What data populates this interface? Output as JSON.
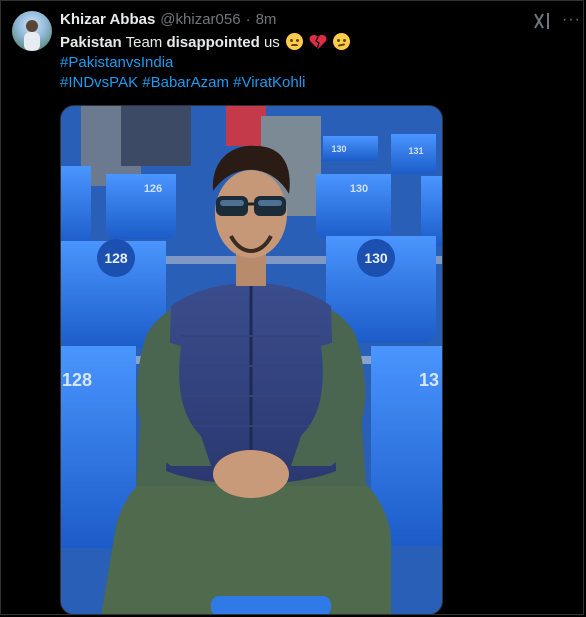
{
  "tweet": {
    "author_name": "Khizar Abbas",
    "handle": "@khizar056",
    "separator": "·",
    "time": "8m",
    "more_label": "···",
    "text": {
      "line1_bold1": "Pakistan",
      "line1_text1": " Team ",
      "line1_bold2": "disappointed",
      "line1_text2": " us ",
      "hashtag1": "#PakistanvsIndia",
      "hashtag2": "#INDvsPAK",
      "hashtag3": "#BabarAzam",
      "hashtag4": "#ViratKohli"
    },
    "emojis": [
      "disappointed-face-emoji",
      "broken-heart-emoji",
      "confused-face-emoji"
    ]
  },
  "photo": {
    "seat_numbers": [
      "126",
      "130",
      "130",
      "131",
      "128",
      "130",
      "128",
      "13"
    ]
  },
  "colors": {
    "background": "#000000",
    "text": "#e7e9ea",
    "secondary": "#71767b",
    "link": "#1d9bf0",
    "seat_blue": "#2f78e0"
  }
}
